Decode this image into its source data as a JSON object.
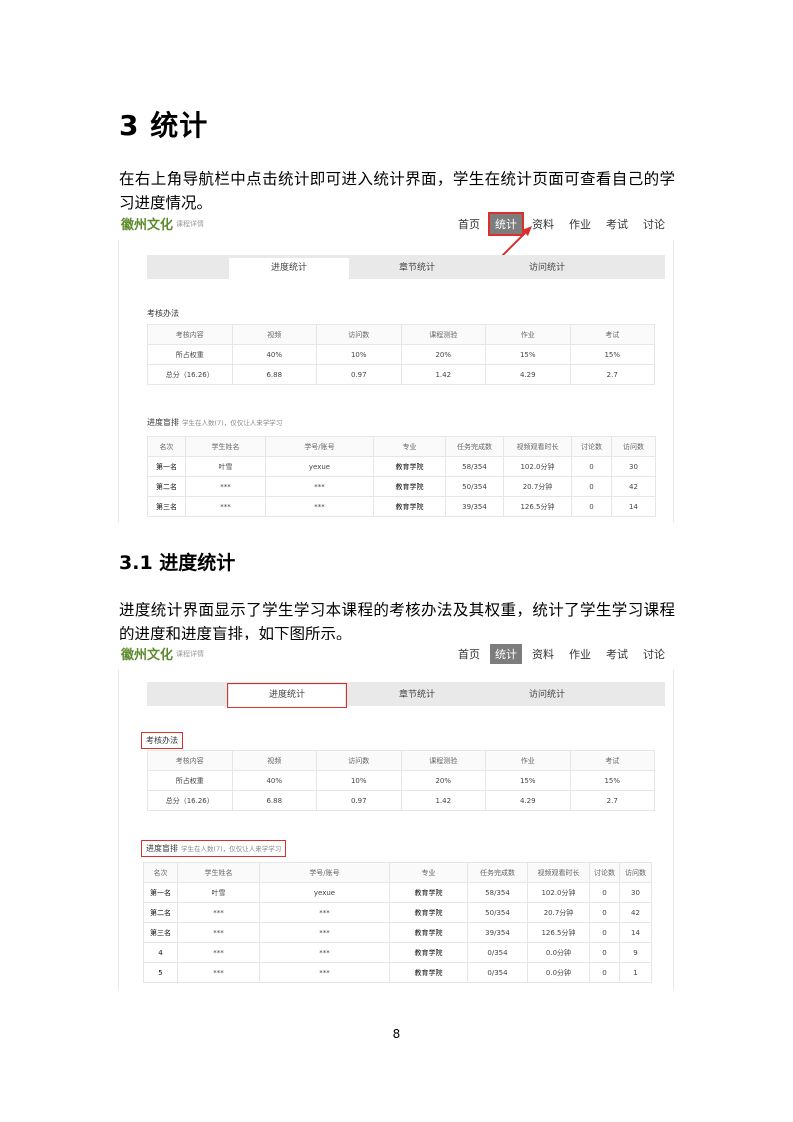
{
  "doc": {
    "heading": "3  统计",
    "intro": "在右上角导航栏中点击统计即可进入统计界面，学生在统计页面可查看自己的学习进度情况。",
    "subheading": "3.1 进度统计",
    "desc": "进度统计界面显示了学生学习本课程的考核办法及其权重，统计了学生学习课程的进度和进度盲排，如下图所示。",
    "page_number": "8"
  },
  "app": {
    "logo": "徽州文化",
    "logo_sub": "课程详情",
    "nav": [
      "首页",
      "统计",
      "资料",
      "作业",
      "考试",
      "讨论"
    ],
    "tabs": [
      "进度统计",
      "章节统计",
      "访问统计"
    ],
    "assess_title": "考核办法",
    "assess_headers": [
      "考核内容",
      "视频",
      "访问数",
      "课程测验",
      "作业",
      "考试"
    ],
    "assess_rows": [
      [
        "所占权重",
        "40%",
        "10%",
        "20%",
        "15%",
        "15%"
      ],
      [
        "总分（16.26）",
        "6.88",
        "0.97",
        "1.42",
        "4.29",
        "2.7"
      ]
    ],
    "rank_title": "进度盲排",
    "rank_hint": "学生在人数(7)，仅仅让人来学学习",
    "rank_headers": [
      "名次",
      "学生姓名",
      "学号/账号",
      "专业",
      "任务完成数",
      "视频观看时长",
      "讨论数",
      "访问数"
    ],
    "rank_rows": [
      [
        "第一名",
        "叶雪",
        "yexue",
        "教育学院",
        "58/354",
        "102.0分钟",
        "0",
        "30"
      ],
      [
        "第二名",
        "***",
        "***",
        "教育学院",
        "50/354",
        "20.7分钟",
        "0",
        "42"
      ],
      [
        "第三名",
        "***",
        "***",
        "教育学院",
        "39/354",
        "126.5分钟",
        "0",
        "14"
      ],
      [
        "4",
        "***",
        "***",
        "教育学院",
        "0/354",
        "0.0分钟",
        "0",
        "9"
      ],
      [
        "5",
        "***",
        "***",
        "教育学院",
        "0/354",
        "0.0分钟",
        "0",
        "1"
      ]
    ]
  },
  "colors": {
    "accent_red": "#d9302c",
    "logo_green": "#5c8a2c",
    "nav_active": "#7d7d7d"
  }
}
